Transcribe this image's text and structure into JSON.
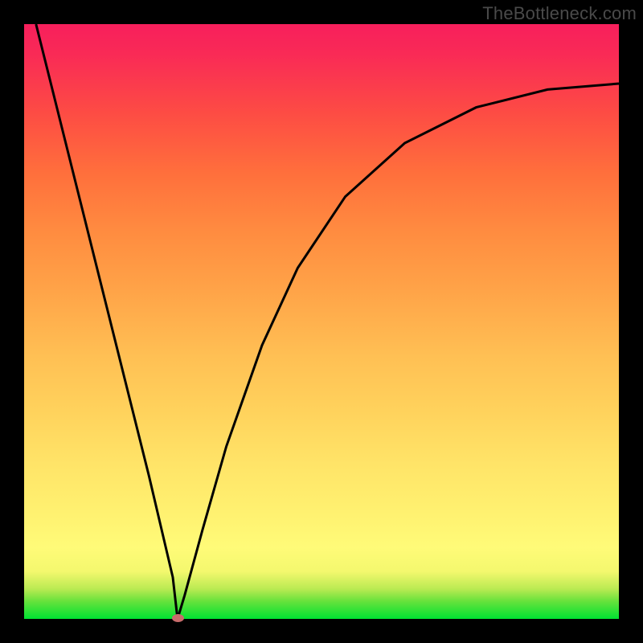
{
  "watermark": {
    "text": "TheBottleneck.com"
  },
  "colors": {
    "frame": "#000000",
    "curve": "#000000",
    "marker": "#c86b6b",
    "gradient_stops": [
      "#00e232",
      "#fffb78",
      "#ff8c40",
      "#f71f5c"
    ]
  },
  "chart_data": {
    "type": "line",
    "title": "",
    "xlabel": "",
    "ylabel": "",
    "xlim": [
      0,
      1
    ],
    "ylim": [
      0,
      1
    ],
    "grid": false,
    "legend": false,
    "annotations": [],
    "series": [
      {
        "name": "bottleneck-curve",
        "description": "V-shaped curve, minimum near x≈0.258",
        "x": [
          0.02,
          0.05,
          0.09,
          0.13,
          0.17,
          0.21,
          0.25,
          0.258,
          0.27,
          0.3,
          0.34,
          0.4,
          0.46,
          0.54,
          0.64,
          0.76,
          0.88,
          1.0
        ],
        "y": [
          1.0,
          0.88,
          0.72,
          0.56,
          0.4,
          0.24,
          0.07,
          0.0,
          0.04,
          0.15,
          0.29,
          0.46,
          0.59,
          0.71,
          0.8,
          0.86,
          0.89,
          0.9
        ]
      }
    ],
    "minimum_marker": {
      "x": 0.258,
      "y": 0.0
    }
  }
}
